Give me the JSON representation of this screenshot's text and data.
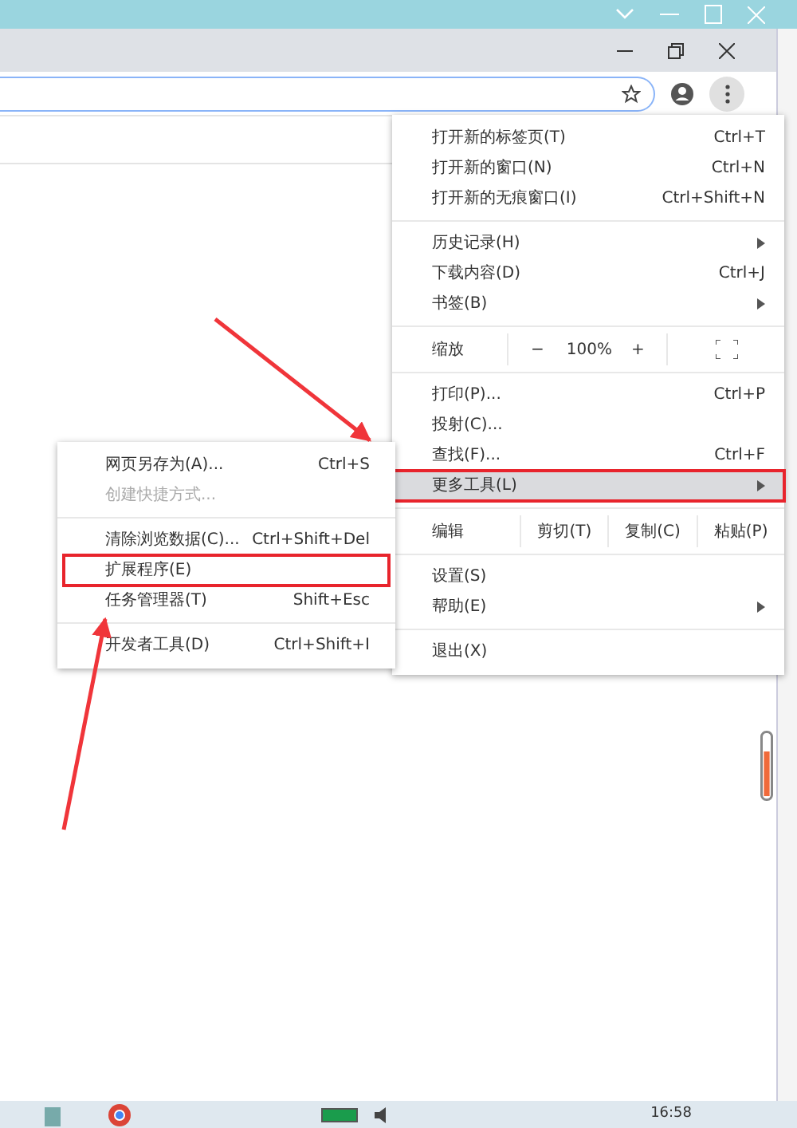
{
  "menu": {
    "items": [
      {
        "kind": "item",
        "label": "打开新的标签页(T)",
        "shortcut": "Ctrl+T",
        "has_submenu": false,
        "selected": false,
        "outlined": false
      },
      {
        "kind": "item",
        "label": "打开新的窗口(N)",
        "shortcut": "Ctrl+N",
        "has_submenu": false,
        "selected": false,
        "outlined": false
      },
      {
        "kind": "item",
        "label": "打开新的无痕窗口(I)",
        "shortcut": "Ctrl+Shift+N",
        "has_submenu": false,
        "selected": false,
        "outlined": false
      },
      {
        "kind": "separator"
      },
      {
        "kind": "item",
        "label": "历史记录(H)",
        "has_submenu": true,
        "selected": false,
        "outlined": false
      },
      {
        "kind": "item",
        "label": "下载内容(D)",
        "shortcut": "Ctrl+J",
        "has_submenu": false,
        "selected": false,
        "outlined": false
      },
      {
        "kind": "item",
        "label": "书签(B)",
        "has_submenu": true,
        "selected": false,
        "outlined": false
      },
      {
        "kind": "separator"
      },
      {
        "kind": "zoom",
        "label": "缩放",
        "minus": "−",
        "value": "100%",
        "plus": "+"
      },
      {
        "kind": "separator"
      },
      {
        "kind": "item",
        "label": "打印(P)...",
        "shortcut": "Ctrl+P",
        "has_submenu": false,
        "selected": false,
        "outlined": false
      },
      {
        "kind": "item",
        "label": "投射(C)...",
        "has_submenu": false,
        "selected": false,
        "outlined": false
      },
      {
        "kind": "item",
        "label": "查找(F)...",
        "shortcut": "Ctrl+F",
        "has_submenu": false,
        "selected": false,
        "outlined": false
      },
      {
        "kind": "item",
        "label": "更多工具(L)",
        "has_submenu": true,
        "selected": true,
        "outlined": true
      },
      {
        "kind": "separator"
      },
      {
        "kind": "edit",
        "label": "编辑",
        "buttons": [
          "剪切(T)",
          "复制(C)",
          "粘贴(P)"
        ]
      },
      {
        "kind": "separator"
      },
      {
        "kind": "item",
        "label": "设置(S)",
        "has_submenu": false,
        "selected": false,
        "outlined": false
      },
      {
        "kind": "item",
        "label": "帮助(E)",
        "has_submenu": true,
        "selected": false,
        "outlined": false
      },
      {
        "kind": "separator"
      },
      {
        "kind": "item",
        "label": "退出(X)",
        "has_submenu": false,
        "selected": false,
        "outlined": false
      }
    ]
  },
  "submenu": {
    "items": [
      {
        "kind": "item",
        "label": "网页另存为(A)...",
        "shortcut": "Ctrl+S",
        "disabled": false,
        "outlined": false
      },
      {
        "kind": "item",
        "label": "创建快捷方式...",
        "disabled": true,
        "outlined": false
      },
      {
        "kind": "separator"
      },
      {
        "kind": "item",
        "label": "清除浏览数据(C)...",
        "shortcut": "Ctrl+Shift+Del",
        "disabled": false,
        "outlined": false
      },
      {
        "kind": "item",
        "label": "扩展程序(E)",
        "disabled": false,
        "outlined": true
      },
      {
        "kind": "item",
        "label": "任务管理器(T)",
        "shortcut": "Shift+Esc",
        "disabled": false,
        "outlined": false
      },
      {
        "kind": "separator"
      },
      {
        "kind": "item",
        "label": "开发者工具(D)",
        "shortcut": "Ctrl+Shift+I",
        "disabled": false,
        "outlined": false
      }
    ]
  },
  "taskbar": {
    "time": "16:58"
  }
}
